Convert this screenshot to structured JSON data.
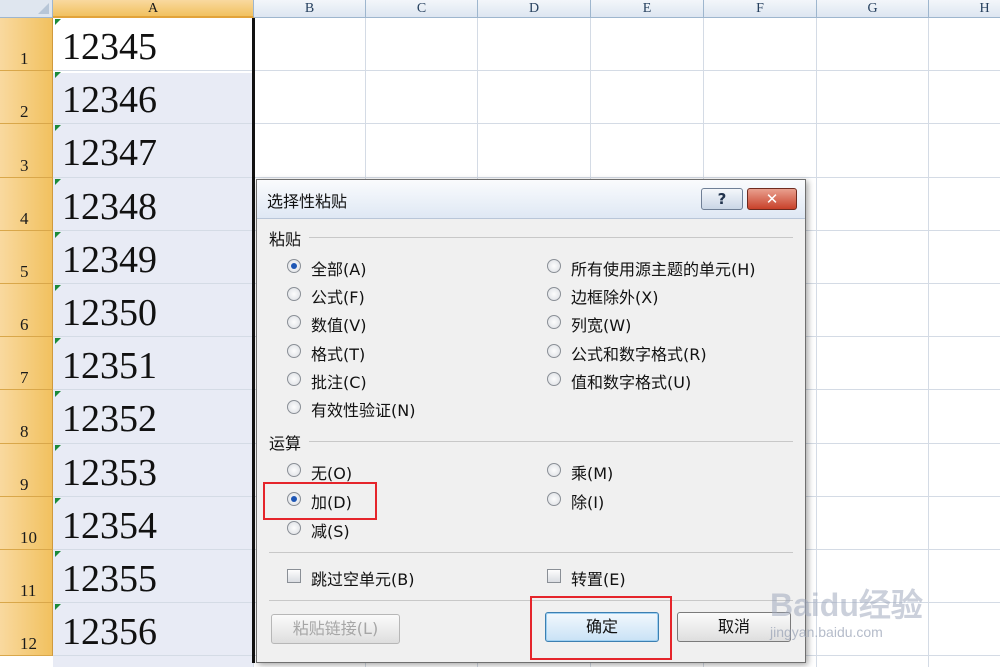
{
  "spreadsheet": {
    "columns": [
      "A",
      "B",
      "C",
      "D",
      "E",
      "F",
      "G",
      "H"
    ],
    "rows": [
      "1",
      "2",
      "3",
      "4",
      "5",
      "6",
      "7",
      "8",
      "9",
      "10",
      "11",
      "12"
    ],
    "values": [
      "12345",
      "12346",
      "12347",
      "12348",
      "12349",
      "12350",
      "12351",
      "12352",
      "12353",
      "12354",
      "12355",
      "12356"
    ]
  },
  "dialog": {
    "title": "选择性粘贴",
    "help_label": "?",
    "close_label": "✕",
    "paste_group": {
      "title": "粘贴",
      "options_left": [
        "全部(A)",
        "公式(F)",
        "数值(V)",
        "格式(T)",
        "批注(C)",
        "有效性验证(N)"
      ],
      "options_right": [
        "所有使用源主题的单元(H)",
        "边框除外(X)",
        "列宽(W)",
        "公式和数字格式(R)",
        "值和数字格式(U)"
      ],
      "selected": "全部(A)"
    },
    "operation_group": {
      "title": "运算",
      "options_left": [
        "无(O)",
        "加(D)",
        "减(S)"
      ],
      "options_right": [
        "乘(M)",
        "除(I)"
      ],
      "selected": "加(D)"
    },
    "checkboxes": {
      "skip_blanks": "跳过空单元(B)",
      "transpose": "转置(E)"
    },
    "buttons": {
      "paste_link": "粘贴链接(L)",
      "ok": "确定",
      "cancel": "取消"
    }
  },
  "watermark": {
    "logo": "Baidu经验",
    "url": "jingyan.baidu.com"
  },
  "colors": {
    "highlight": "#e5252b",
    "radio_dot": "#1d56b5",
    "row_header": "#f1c15f"
  }
}
